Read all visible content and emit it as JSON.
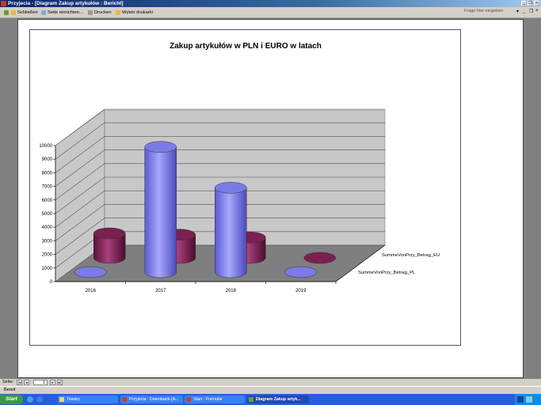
{
  "window": {
    "title": "Przyjecia - [Diagram Zakup artykułów : Bericht]"
  },
  "toolbar": {
    "close_label": "Schließen",
    "page_setup_label": "Seite einrichten...",
    "print_label": "Drucken",
    "printer_select_label": "Wybór drukarki",
    "help_placeholder": "Frage hier eingeben"
  },
  "chart_data": {
    "type": "bar",
    "style": "3d-cylinder",
    "title": "Zakup artykułów w PLN i EURO w latach",
    "categories": [
      "2016",
      "2017",
      "2018",
      "2019"
    ],
    "series": [
      {
        "name": "SummeVonPrzy_Betrag_EU",
        "values": [
          1800,
          1700,
          1500,
          0
        ],
        "color": "#7a1f4f"
      },
      {
        "name": "SummeVonPrzy_Betrag_PL",
        "values": [
          0,
          9200,
          6200,
          0
        ],
        "color": "#7b7be8"
      }
    ],
    "y_ticks": [
      "0",
      "1000",
      "2000",
      "3000",
      "4000",
      "5000",
      "6000",
      "7000",
      "8000",
      "9000",
      "10000"
    ],
    "ylim": [
      0,
      10000
    ],
    "grid": true
  },
  "nav": {
    "page_label": "Seite:",
    "page_value": "1"
  },
  "status": {
    "text": "Bereit"
  },
  "taskbar": {
    "start_label": "Start",
    "tasks": [
      "Towary",
      "Przyjecia : Datenbank (A...",
      "Start : Formular",
      "Diagram Zakup artyk..."
    ]
  }
}
